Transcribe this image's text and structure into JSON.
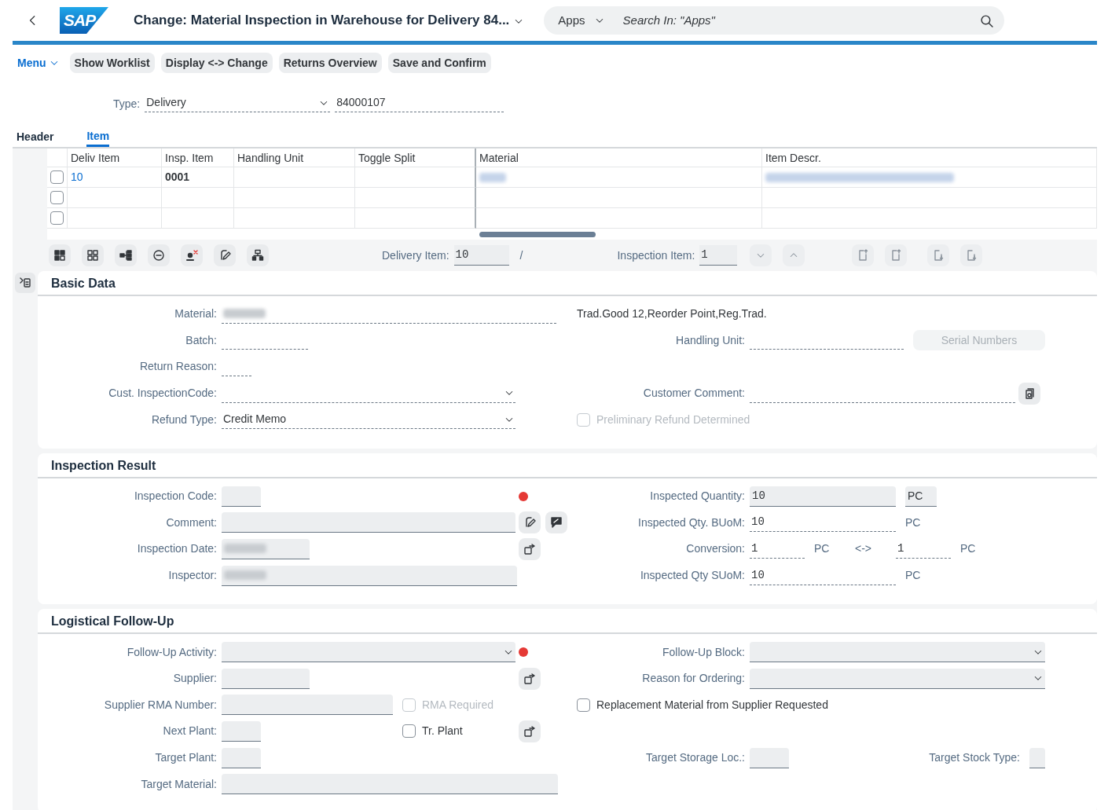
{
  "shell": {
    "logo": "SAP",
    "title": "Change: Material Inspection in Warehouse for Delivery 84...",
    "scope": "Apps",
    "search_placeholder": "Search In: \"Apps\""
  },
  "toolbar": {
    "menu": "Menu",
    "buttons": [
      "Show Worklist",
      "Display <-> Change",
      "Returns Overview",
      "Save and Confirm"
    ]
  },
  "selection": {
    "label": "Type:",
    "type": "Delivery",
    "number": "84000107"
  },
  "tabs": [
    {
      "label": "Header",
      "selected": false
    },
    {
      "label": "Item",
      "selected": true
    }
  ],
  "table": {
    "columns": [
      "Deliv Item",
      "Insp. Item",
      "Handling Unit",
      "Toggle Split",
      "Material",
      "Item Descr."
    ],
    "rows": [
      {
        "selected": false,
        "deliv_item": "10",
        "insp_item": "0001",
        "masked": true
      },
      {
        "selected": false
      },
      {
        "selected": false
      }
    ]
  },
  "navigator": {
    "delivery_item_label": "Delivery Item:",
    "delivery_item": "10",
    "separator": "/",
    "inspection_item_label": "Inspection Item:",
    "inspection_item": "1"
  },
  "sections": [
    {
      "title": "Basic Data",
      "rows": [
        {
          "left": [
            {
              "kind": "label",
              "text": "Material:"
            },
            {
              "kind": "display",
              "masked": true
            }
          ],
          "right": [
            {
              "kind": "text",
              "text": "Trad.Good 12,Reorder Point,Reg.Trad."
            }
          ]
        },
        {
          "left": [
            {
              "kind": "label",
              "text": "Batch:"
            },
            {
              "kind": "display"
            }
          ],
          "right": [
            {
              "kind": "label",
              "text": "Handling Unit:"
            },
            {
              "kind": "display"
            },
            {
              "kind": "button",
              "text": "Serial Numbers",
              "disabled": true
            }
          ]
        },
        {
          "left": [
            {
              "kind": "label",
              "text": "Return Reason:"
            },
            {
              "kind": "display"
            }
          ],
          "right": []
        },
        {
          "left": [
            {
              "kind": "label",
              "text": "Cust. InspectionCode:"
            },
            {
              "kind": "display-select"
            }
          ],
          "right": [
            {
              "kind": "label",
              "text": "Customer Comment:"
            },
            {
              "kind": "display"
            },
            {
              "kind": "icon-button"
            }
          ]
        },
        {
          "left": [
            {
              "kind": "label",
              "text": "Refund Type:"
            },
            {
              "kind": "display-select",
              "value": "Credit Memo"
            }
          ],
          "right": [
            {
              "kind": "checkbox",
              "text": "Preliminary Refund Determined",
              "checked": false,
              "disabled": true
            }
          ]
        }
      ]
    },
    {
      "title": "Inspection Result",
      "rows": [
        {
          "left": [
            {
              "kind": "label",
              "text": "Inspection Code:"
            },
            {
              "kind": "input"
            },
            {
              "kind": "status",
              "color": "#e53935"
            }
          ],
          "right": [
            {
              "kind": "label",
              "text": "Inspected Quantity:"
            },
            {
              "kind": "input",
              "value": "10"
            },
            {
              "kind": "unit-input",
              "value": "PC"
            }
          ]
        },
        {
          "left": [
            {
              "kind": "label",
              "text": "Comment:"
            },
            {
              "kind": "input"
            },
            {
              "kind": "icon-button"
            },
            {
              "kind": "icon-button"
            }
          ],
          "right": [
            {
              "kind": "label",
              "text": "Inspected Qty. BUoM:"
            },
            {
              "kind": "display",
              "value": "10"
            },
            {
              "kind": "unit",
              "text": "PC"
            }
          ]
        },
        {
          "left": [
            {
              "kind": "label",
              "text": "Inspection Date:"
            },
            {
              "kind": "input",
              "masked": true
            },
            {
              "kind": "icon-button"
            }
          ],
          "right": [
            {
              "kind": "label",
              "text": "Conversion:"
            },
            {
              "kind": "display",
              "value": "1"
            },
            {
              "kind": "unit",
              "text": "PC"
            },
            {
              "kind": "unit",
              "text": "<->"
            },
            {
              "kind": "display",
              "value": "1"
            },
            {
              "kind": "unit",
              "text": "PC"
            }
          ]
        },
        {
          "left": [
            {
              "kind": "label",
              "text": "Inspector:"
            },
            {
              "kind": "input",
              "masked": true
            }
          ],
          "right": [
            {
              "kind": "label",
              "text": "Inspected Qty SUoM:"
            },
            {
              "kind": "display",
              "value": "10"
            },
            {
              "kind": "unit",
              "text": "PC"
            }
          ]
        }
      ]
    },
    {
      "title": "Logistical Follow-Up",
      "rows": [
        {
          "left": [
            {
              "kind": "label",
              "text": "Follow-Up Activity:"
            },
            {
              "kind": "input-select"
            },
            {
              "kind": "status",
              "color": "#e53935"
            }
          ],
          "right": [
            {
              "kind": "label",
              "text": "Follow-Up Block:"
            },
            {
              "kind": "input-select"
            }
          ]
        },
        {
          "left": [
            {
              "kind": "label",
              "text": "Supplier:"
            },
            {
              "kind": "input"
            },
            {
              "kind": "icon-button"
            }
          ],
          "right": [
            {
              "kind": "label",
              "text": "Reason for Ordering:"
            },
            {
              "kind": "input-select"
            }
          ]
        },
        {
          "left": [
            {
              "kind": "label",
              "text": "Supplier RMA Number:"
            },
            {
              "kind": "input"
            },
            {
              "kind": "checkbox",
              "text": "RMA Required",
              "checked": false,
              "disabled": true
            }
          ],
          "right": [
            {
              "kind": "checkbox",
              "text": "Replacement Material from Supplier Requested",
              "checked": false,
              "disabled": false
            }
          ]
        },
        {
          "left": [
            {
              "kind": "label",
              "text": "Next Plant:"
            },
            {
              "kind": "input"
            },
            {
              "kind": "checkbox",
              "text": "Tr. Plant",
              "checked": false,
              "disabled": false
            },
            {
              "kind": "icon-button"
            }
          ],
          "right": []
        },
        {
          "left": [
            {
              "kind": "label",
              "text": "Target Plant:"
            },
            {
              "kind": "input"
            }
          ],
          "right": [
            {
              "kind": "label",
              "text": "Target Storage Loc.:"
            },
            {
              "kind": "input"
            },
            {
              "kind": "label",
              "text": "Target Stock Type:"
            },
            {
              "kind": "input"
            }
          ]
        },
        {
          "left": [
            {
              "kind": "label",
              "text": "Target Material:"
            },
            {
              "kind": "input"
            }
          ],
          "right": []
        }
      ]
    }
  ]
}
